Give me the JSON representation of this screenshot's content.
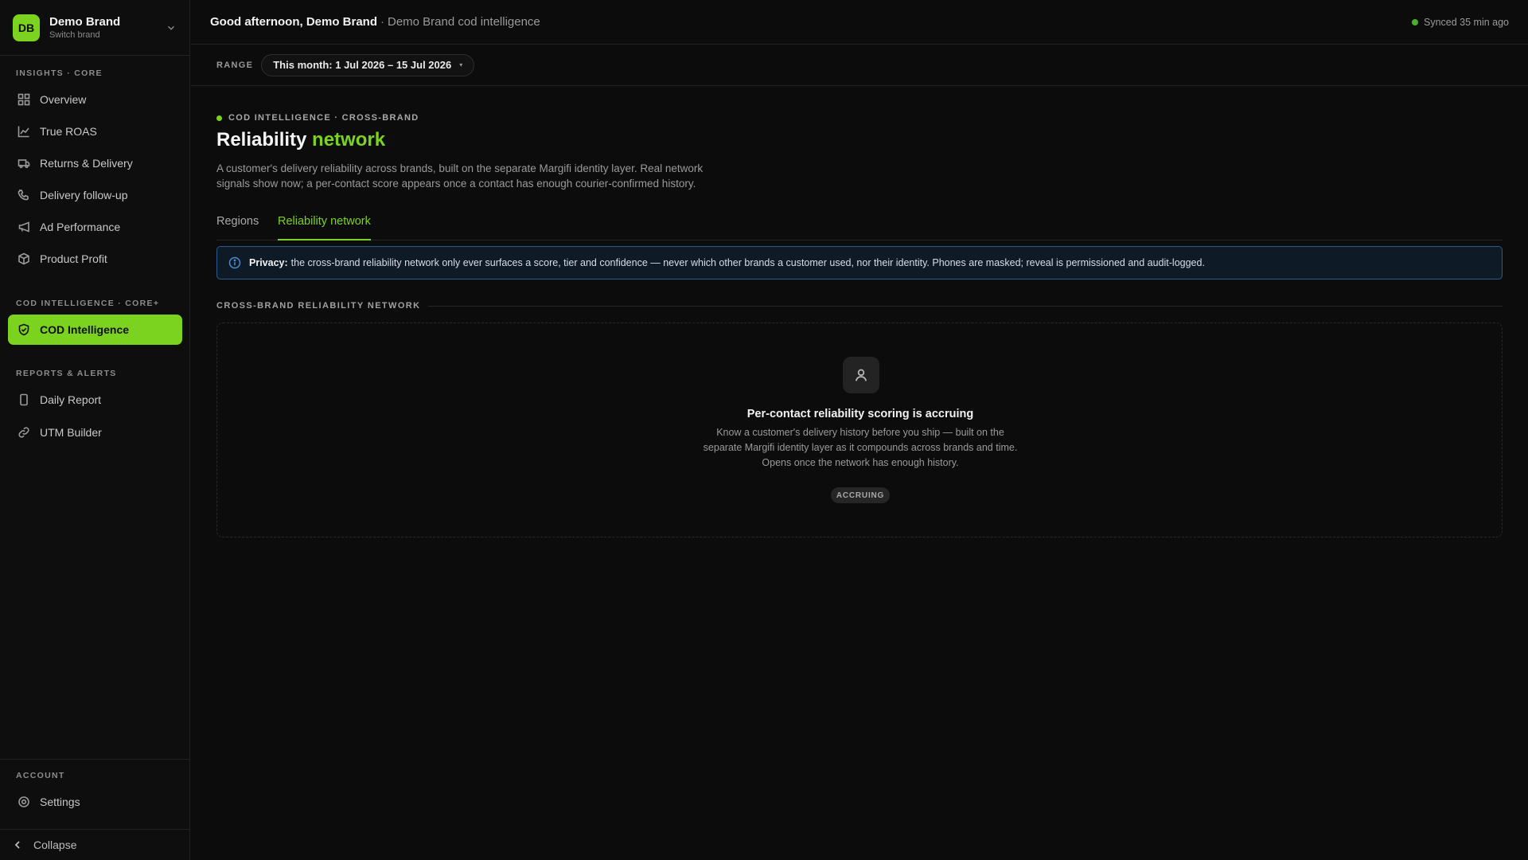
{
  "brand": {
    "initials": "DB",
    "name": "Demo Brand",
    "sub": "Switch brand"
  },
  "sidebar": {
    "sections": [
      {
        "title": "INSIGHTS · CORE",
        "items": [
          "Overview",
          "True ROAS",
          "Returns & Delivery",
          "Delivery follow-up",
          "Ad Performance",
          "Product Profit"
        ]
      },
      {
        "title": "COD INTELLIGENCE · CORE+",
        "items": [
          "COD Intelligence"
        ]
      },
      {
        "title": "REPORTS & ALERTS",
        "items": [
          "Daily Report",
          "UTM Builder"
        ]
      },
      {
        "title": "ACCOUNT",
        "items": [
          "Settings"
        ]
      }
    ],
    "collapse": "Collapse"
  },
  "header": {
    "greeting": "Good afternoon, Demo Brand",
    "separator": "·",
    "subtitle": "Demo Brand cod intelligence",
    "synced": "Synced 35 min ago"
  },
  "range": {
    "label": "RANGE",
    "value": "This month: 1 Jul 2026 – 15 Jul 2026",
    "caret": "▾"
  },
  "page": {
    "eyebrow": "COD INTELLIGENCE · CROSS-BRAND",
    "title_main": "Reliability",
    "title_accent": "network",
    "description": "A customer's delivery reliability across brands, built on the separate Margifi identity layer. Real network signals show now; a per-contact score appears once a contact has enough courier-confirmed history.",
    "tabs": [
      "Regions",
      "Reliability network"
    ],
    "privacy_label": "Privacy:",
    "privacy_text": "the cross-brand reliability network only ever surfaces a score, tier and confidence — never which other brands a customer used, nor their identity. Phones are masked; reveal is permissioned and audit-logged.",
    "section_title": "CROSS-BRAND RELIABILITY NETWORK",
    "empty_title": "Per-contact reliability scoring is accruing",
    "empty_desc": "Know a customer's delivery history before you ship — built on the separate Margifi identity layer as it compounds across brands and time. Opens once the network has enough history.",
    "badge": "ACCRUING"
  },
  "colors": {
    "accent": "#7bd31f",
    "synced_dot": "#4caf2a",
    "privacy_border": "#2d5a8e"
  }
}
